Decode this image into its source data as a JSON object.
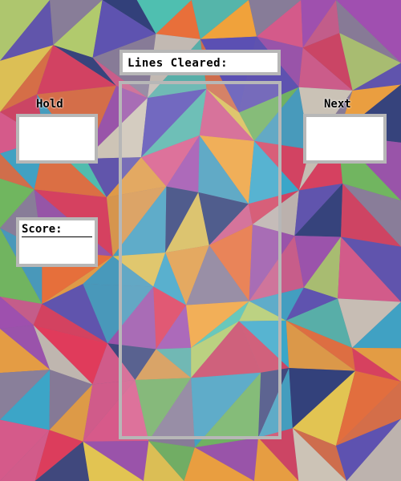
{
  "hud": {
    "lines_label": "Lines Cleared:",
    "hold_label": "Hold",
    "next_label": "Next",
    "score_label": "Score:"
  }
}
